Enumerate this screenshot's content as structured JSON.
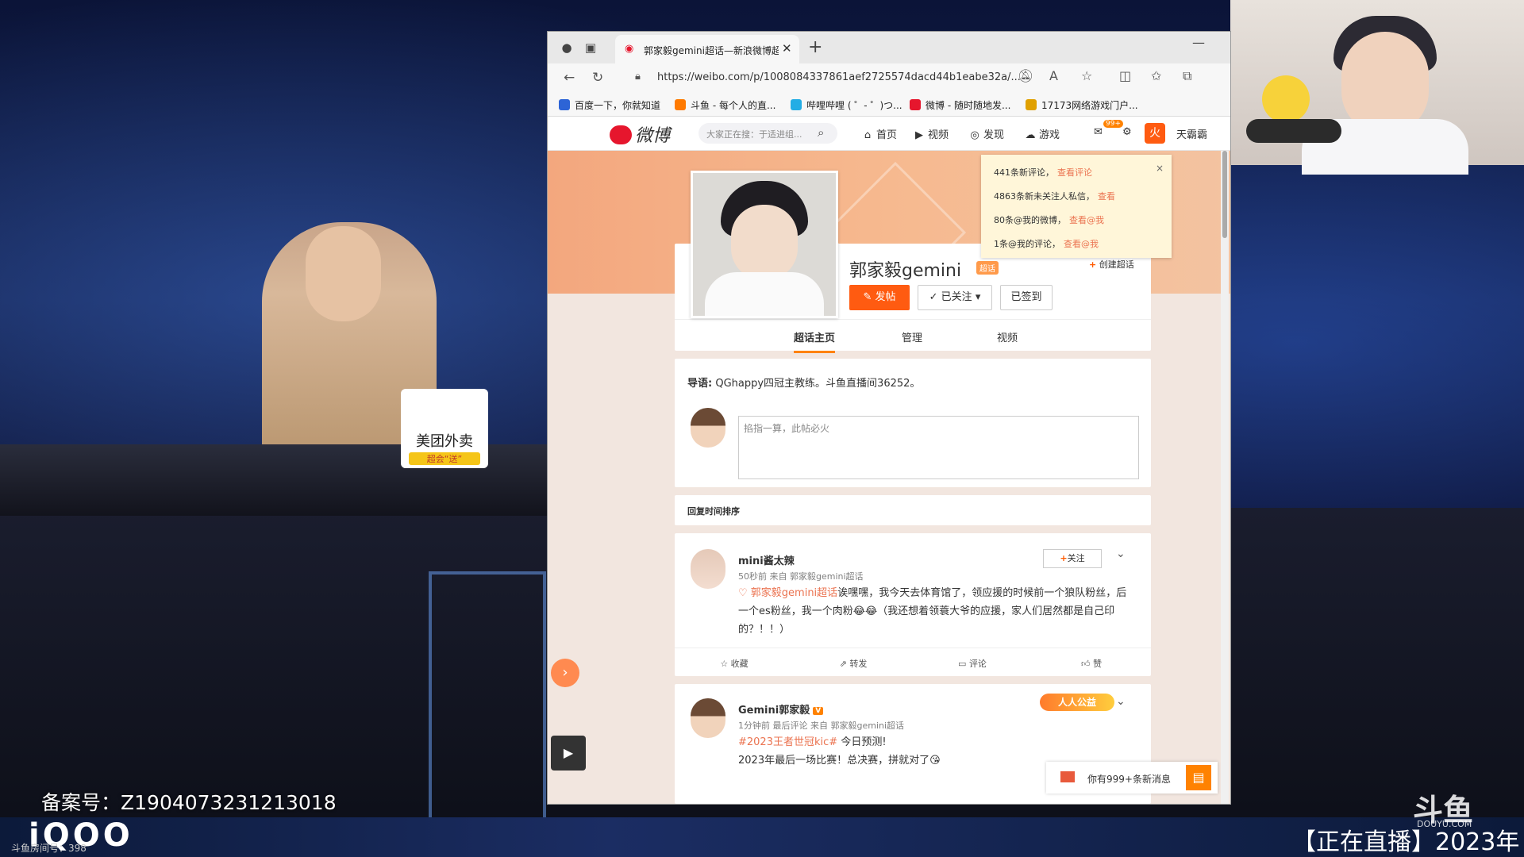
{
  "stream": {
    "record_no": "备案号：Z1904073231213018",
    "brand": "iQOO",
    "room_no": "斗鱼房间号：398",
    "live_status": "【正在直播】2023年",
    "platform_logo": "斗鱼",
    "platform_site": "DOUYU.COM",
    "promo_card_title": "美团外卖",
    "promo_card_sub": "超会“送”"
  },
  "browser": {
    "tab_title": "郭家毅gemini超话—新浪微博超话",
    "url": "https://weibo.com/p/1008084337861aef2725574dacd44b1eabe32a/...",
    "bookmarks": [
      {
        "label": "百度一下，你就知道",
        "color": "#2d64d6"
      },
      {
        "label": "斗鱼 - 每个人的直...",
        "color": "#ff7a00"
      },
      {
        "label": "哔哩哔哩 ( ゜- ゜)つ...",
        "color": "#23ade5"
      },
      {
        "label": "微博 - 随时随地发...",
        "color": "#e6162d"
      },
      {
        "label": "17173网络游戏门户...",
        "color": "#e0a000"
      }
    ]
  },
  "weibo": {
    "logo": "微博",
    "search_placeholder": "大家正在搜：于适进组...",
    "nav": {
      "home": "首页",
      "video": "视频",
      "discover": "发现",
      "game": "游戏",
      "badge": "99+",
      "username": "天霸霸"
    },
    "notify": {
      "rows": [
        {
          "text": "441条新评论，",
          "link": "查看评论"
        },
        {
          "text": "4863条新未关注人私信，",
          "link": "查看"
        },
        {
          "text": "80条@我的微博，",
          "link": "查看@我"
        },
        {
          "text": "1条@我的评论，",
          "link": "查看@我"
        }
      ],
      "close": "×"
    },
    "profile": {
      "name": "郭家毅gemini",
      "badge": "超话",
      "create_topic": "创建超话",
      "post_btn": "发帖",
      "follow_btn": "已关注",
      "signed_btn": "已签到",
      "tabs": [
        "超话主页",
        "管理",
        "视频"
      ]
    },
    "intro": {
      "label": "导语:",
      "text": "QGhappy四冠主教练。斗鱼直播间36252。",
      "input_placeholder": "掐指一算，此帖必火"
    },
    "sort_label": "回复时间排序",
    "posts": [
      {
        "name": "mini酱太辣",
        "meta": "50秒前 来自 郭家毅gemini超话",
        "tag": "郭家毅gemini超话",
        "text": "诶嘿嘿，我今天去体育馆了，领应援的时候前一个狼队粉丝，后一个es粉丝，我一个肉粉😂😂（我还想着领蓑大爷的应援，家人们居然都是自己印的？！！）",
        "follow": "关注",
        "actions": [
          "收藏",
          "转发",
          "评论",
          "赞"
        ]
      },
      {
        "name": "Gemini郭家毅",
        "vbadge": "V",
        "meta": "1分钟前 最后评论 来自 郭家毅gemini超话",
        "tag": "#2023王者世冠kic#",
        "text_line1": "今日预测!",
        "text_line2": "2023年最后一场比赛！总决赛，拼就对了😘",
        "gold_badge": "人人公益"
      }
    ],
    "msg_bar": "你有999+条新消息"
  }
}
